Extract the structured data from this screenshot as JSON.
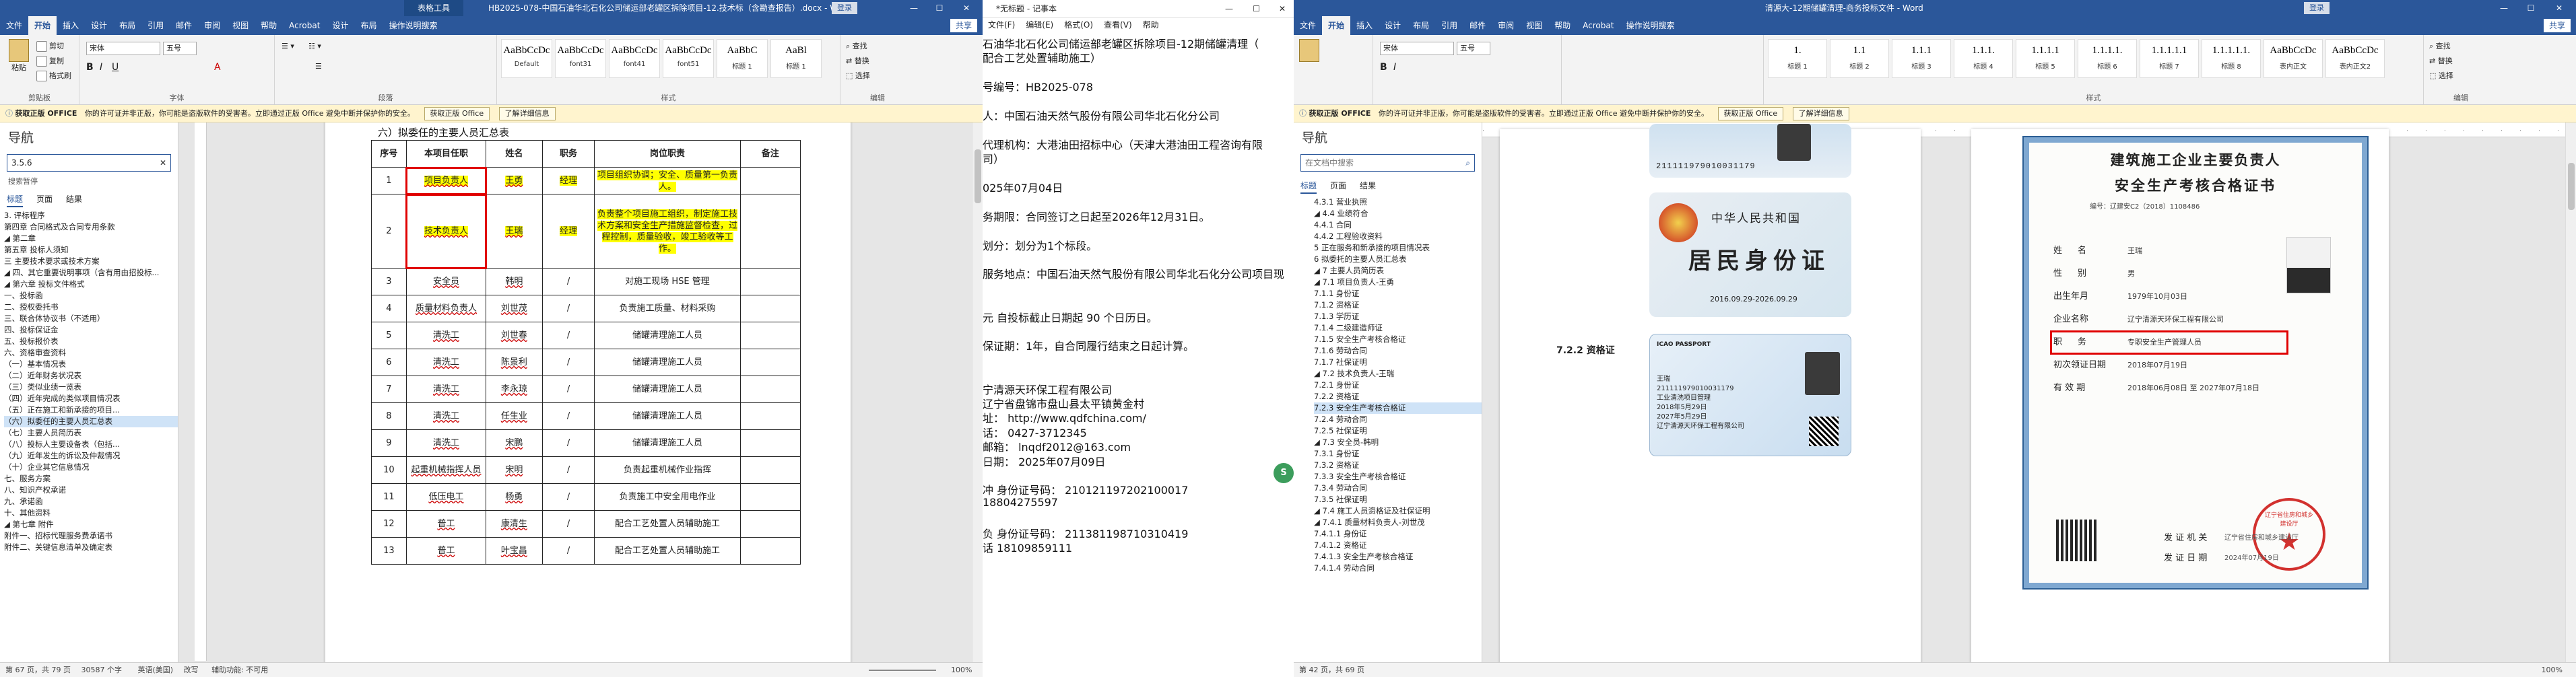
{
  "left_word": {
    "title": "HB2025-078-中国石油华北石化公司储运部老罐区拆除项目-12.技术标（含勘查报告）.docx - Word",
    "table_tools": "表格工具",
    "login_button": "登录",
    "tabs": [
      "文件",
      "开始",
      "插入",
      "设计",
      "布局",
      "引用",
      "邮件",
      "审阅",
      "视图",
      "帮助",
      "Acrobat",
      "设计",
      "布局",
      "操作说明搜索"
    ],
    "share": "共享",
    "ribbon": {
      "clipboard": {
        "paste": "粘贴",
        "cut": "剪切",
        "copy": "复制",
        "format_painter": "格式刷",
        "label": "剪贴板"
      },
      "font": {
        "name": "宋体",
        "size": "五号",
        "label": "字体"
      },
      "paragraph": {
        "label": "段落"
      },
      "styles": [
        {
          "preview": "AaBbCcDc",
          "name": "Default"
        },
        {
          "preview": "AaBbCcDc",
          "name": "font31"
        },
        {
          "preview": "AaBbCcDc",
          "name": "font41"
        },
        {
          "preview": "AaBbCcDc",
          "name": "font51"
        },
        {
          "preview": "AaBbC",
          "name": "标题 1"
        },
        {
          "preview": "AaBl",
          "name": "标题 1"
        }
      ],
      "styles_label": "样式",
      "editing": {
        "find": "查找",
        "replace": "替换",
        "select": "选择",
        "label": "编辑"
      }
    },
    "msgbar": {
      "title": "获取正版 OFFICE",
      "text": "你的许可证并非正版，你可能是盗版软件的受害者。立即通过正版 Office 避免中断并保护你的安全。",
      "btn1": "获取正版 Office",
      "btn2": "了解详细信息"
    },
    "nav": {
      "title": "导航",
      "search_value": "3.5.6",
      "search_hint": "搜索暂停",
      "tabs": [
        "标题",
        "页面",
        "结果"
      ],
      "items": [
        "3. 评标程序",
        "第四章 合同格式及合同专用条款",
        "◢ 第二章",
        "第五章 投标人须知",
        "三 主要技术要求或技术方案",
        "◢ 四、其它重要说明事项（含有用由招投标...",
        "◢ 第六章 投标文件格式",
        "一、投标函",
        "二、授权委托书",
        "三、联合体协议书（不适用）",
        "四、投标保证金",
        "五、投标报价表",
        "六、资格审查资料",
        "（一）基本情况表",
        "（二）近年财务状况表",
        "（三）类似业绩一览表",
        "（四）近年完成的类似项目情况表",
        "（五）正在施工和新承接的项目...",
        "（六）拟委任的主要人员汇总表",
        "（七）主要人员简历表",
        "（八）投标人主要设备表（包括...",
        "（九）近年发生的诉讼及仲裁情况",
        "（十）企业其它信息情况",
        "七、服务方案",
        "八、知识产权承诺",
        "九、承诺函",
        "十、其他资料",
        "◢ 第七章 附件",
        "附件一、招标代理服务费承诺书",
        "附件二、关键信息清单及确定表"
      ],
      "selected_index": 18
    },
    "doc_heading": "六）拟委任的主要人员汇总表",
    "table": {
      "headers": [
        "序号",
        "本项目任职",
        "姓名",
        "职务",
        "岗位职责",
        "备注"
      ],
      "rows": [
        [
          "1",
          "项目负责人",
          "王勇",
          "经理",
          "项目组织协调；安全、质量第一负责人。",
          ""
        ],
        [
          "2",
          "技术负责人",
          "王瑞",
          "经理",
          "负责整个项目施工组织，制定施工技术方案和安全生产措施监督检查，过程控制，质量验收，竣工验收等工作。",
          ""
        ],
        [
          "3",
          "安全员",
          "韩明",
          "/",
          "对施工现场 HSE 管理",
          ""
        ],
        [
          "4",
          "质量材料负责人",
          "刘世茂",
          "/",
          "负责施工质量、材料采购",
          ""
        ],
        [
          "5",
          "清洗工",
          "刘世春",
          "/",
          "储罐清理施工人员",
          ""
        ],
        [
          "6",
          "清洗工",
          "陈景利",
          "/",
          "储罐清理施工人员",
          ""
        ],
        [
          "7",
          "清洗工",
          "李永琼",
          "/",
          "储罐清理施工人员",
          ""
        ],
        [
          "8",
          "清洗工",
          "任生业",
          "/",
          "储罐清理施工人员",
          ""
        ],
        [
          "9",
          "清洗工",
          "宋鹏",
          "/",
          "储罐清理施工人员",
          ""
        ],
        [
          "10",
          "起重机械指挥人员",
          "宋明",
          "/",
          "负责起重机械作业指挥",
          ""
        ],
        [
          "11",
          "低压电工",
          "杨勇",
          "/",
          "负责施工中安全用电作业",
          ""
        ],
        [
          "12",
          "普工",
          "康清生",
          "/",
          "配合工艺处置人员辅助施工",
          ""
        ],
        [
          "13",
          "普工",
          "叶宝昌",
          "/",
          "配合工艺处置人员辅助施工",
          ""
        ]
      ]
    },
    "status": {
      "page": "第 67 页，共 79 页",
      "words": "30587 个字",
      "lang": "英语(美国)",
      "mode": "改写",
      "accessibility": "辅助功能: 不可用",
      "zoom": "100%"
    }
  },
  "notepad": {
    "title": "*无标题 - 记事本",
    "menu": [
      "文件(F)",
      "编辑(E)",
      "格式(O)",
      "查看(V)",
      "帮助"
    ],
    "lines": [
      "石油华北石化公司储运部老罐区拆除项目-12期储罐清理（",
      "配合工艺处置辅助施工）",
      "",
      "号编号：HB2025-078",
      "",
      "人：中国石油天然气股份有限公司华北石化分公司",
      "",
      "代理机构：大港油田招标中心（天津大港油田工程咨询有限",
      "司）",
      "",
      "025年07月04日",
      "",
      "务期限：合同签订之日起至2026年12月31日。",
      "",
      "划分：划分为1个标段。",
      "",
      "服务地点：中国石油天然气股份有限公司华北石化分公司项目现",
      "",
      "",
      "元  自投标截止日期起   90   个日历日。",
      "",
      "保证期：1年，自合同履行结束之日起计算。",
      "",
      "",
      "宁清源天环保工程有限公司",
      "辽宁省盘锦市盘山县太平镇黄金村",
      "址：       http://www.qdfchina.com/",
      "话：       0427-3712345",
      "邮箱：     lnqdf2012@163.com",
      "日期：     2025年07月09日",
      "",
      "冲    身份证号码：      210121197202100017",
      "       18804275597",
      "",
      "负       身份证号码：    211381198710310419",
      "话       18109859111"
    ]
  },
  "right_word": {
    "title": "清源大-12期储罐清理-商务投标文件 - Word",
    "login_button": "登录",
    "tabs": [
      "文件",
      "开始",
      "插入",
      "设计",
      "布局",
      "引用",
      "邮件",
      "审阅",
      "视图",
      "帮助",
      "Acrobat",
      "操作说明搜索"
    ],
    "share": "共享",
    "ribbon": {
      "font": {
        "name": "宋体",
        "size": "五号"
      },
      "styles": [
        {
          "preview": "1.",
          "name": "标题 1"
        },
        {
          "preview": "1.1",
          "name": "标题 2"
        },
        {
          "preview": "1.1.1",
          "name": "标题 3"
        },
        {
          "preview": "1.1.1.",
          "name": "标题 4"
        },
        {
          "preview": "1.1.1.1",
          "name": "标题 5"
        },
        {
          "preview": "1.1.1.1.",
          "name": "标题 6"
        },
        {
          "preview": "1.1.1.1.1",
          "name": "标题 7"
        },
        {
          "preview": "1.1.1.1.1.",
          "name": "标题 8"
        },
        {
          "preview": "AaBbCcDc",
          "name": "表内正文"
        },
        {
          "preview": "AaBbCcDc",
          "name": "表内正文2"
        }
      ],
      "styles_label": "样式",
      "editing": {
        "find": "查找",
        "replace": "替换",
        "select": "选择",
        "label": "编辑"
      }
    },
    "msgbar": {
      "title": "获取正版 OFFICE",
      "text": "你的许可证并非正版，你可能是盗版软件的受害者。立即通过正版 Office 避免中断并保护你的安全。",
      "btn1": "获取正版 Office",
      "btn2": "了解详细信息"
    },
    "nav": {
      "title": "导航",
      "search_placeholder": "在文档中搜索",
      "tabs": [
        "标题",
        "页面",
        "结果"
      ],
      "items": [
        "4.3.1 营业执照",
        "◢ 4.4 业绩符合",
        "4.4.1 合同",
        "4.4.2 工程验收资料",
        "5 正在服务和新承接的项目情况表",
        "6 拟委托的主要人员汇总表",
        "◢ 7 主要人员简历表",
        "◢ 7.1 项目负责人-王勇",
        "7.1.1 身份证",
        "7.1.2 资格证",
        "7.1.3 学历证",
        "7.1.4 二级建造师证",
        "7.1.5 安全生产考核合格证",
        "7.1.6 劳动合同",
        "7.1.7 社保证明",
        "◢ 7.2 技术负责人-王瑞",
        "7.2.1 身份证",
        "7.2.2 资格证",
        "7.2.3 安全生产考核合格证",
        "7.2.4 劳动合同",
        "7.2.5 社保证明",
        "◢ 7.3 安全员-韩明",
        "7.3.1 身份证",
        "7.3.2 资格证",
        "7.3.3 安全生产考核合格证",
        "7.3.4 劳动合同",
        "7.3.5 社保证明",
        "◢ 7.4 施工人员资格证及社保证明",
        "◢ 7.4.1 质量材料负责人-刘世茂",
        "7.4.1.1 身份证",
        "7.4.1.2 资格证",
        "7.4.1.3 安全生产考核合格证",
        "7.4.1.4 劳动合同"
      ],
      "selected_index": 18
    },
    "left_page": {
      "heading": "7.2.2 资格证",
      "id_number": "211111979010031179",
      "card_back_country": "中华人民共和国",
      "card_back_title": "居民身份证",
      "card_back_dates": "2016.09.29-2026.09.29",
      "ic_card_label": "ICAO PASSPORT",
      "ic_fields": [
        "王瑞",
        "211111979010031179",
        "工业清洗项目管理",
        "2018年5月29日",
        "2027年5月29日",
        "辽宁清源天环保工程有限公司"
      ]
    },
    "cert": {
      "title1": "建筑施工企业主要负责人",
      "title2": "安全生产考核合格证书",
      "number": "编号：辽建安C2（2018）1108486",
      "rows": [
        [
          "姓",
          "名",
          "王瑞"
        ],
        [
          "性",
          "别",
          "男"
        ],
        [
          "出生年月",
          "",
          "1979年10月03日"
        ],
        [
          "企业名称",
          "",
          "辽宁清源天环保工程有限公司"
        ],
        [
          "职",
          "务",
          "专职安全生产管理人员"
        ],
        [
          "初次领证日期",
          "",
          "2018年07月19日"
        ],
        [
          "有  效  期",
          "",
          "2018年06月08日   至   2027年07月18日"
        ]
      ],
      "issuer_label": "发 证 机 关",
      "issuer": "辽宁省住房和城乡建设厅",
      "issue_date_label": "发 证 日 期",
      "issue_date": "2024年07月19日",
      "seal_text": "辽宁省住房和城乡建设厅"
    },
    "status": {
      "page": "第 42 页，共 69 页",
      "zoom": "100%"
    }
  }
}
